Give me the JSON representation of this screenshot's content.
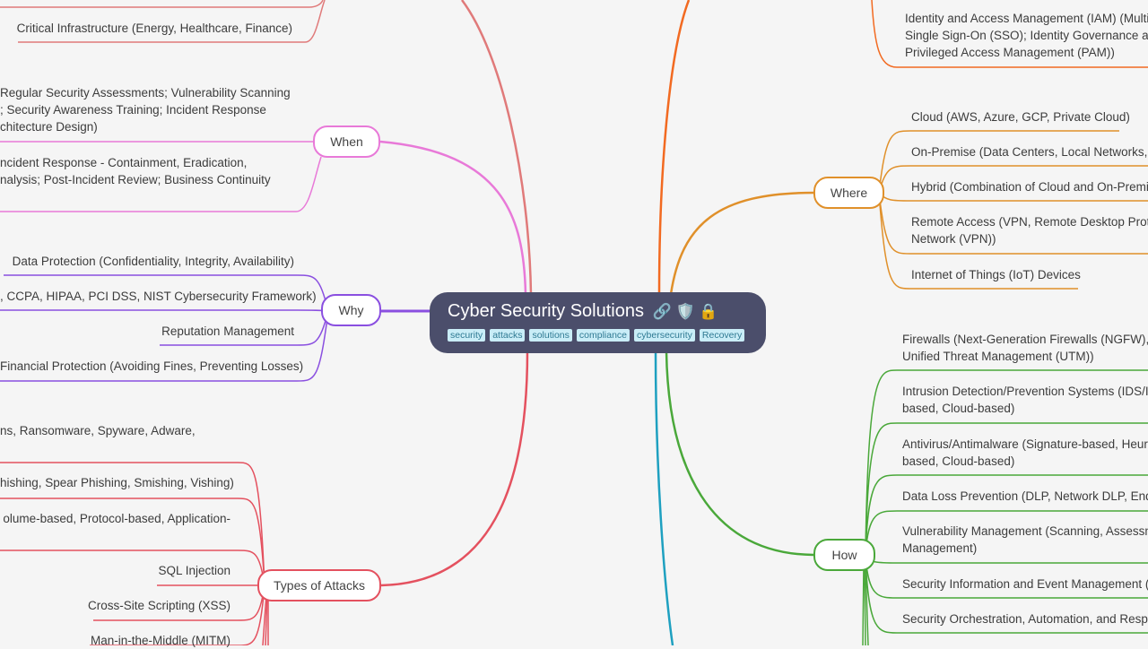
{
  "root": {
    "title": "Cyber Security Solutions",
    "icons": [
      "link-icon",
      "shield-icon",
      "lock-icon"
    ],
    "icon_glyphs": "🔗 🛡️ 🔒",
    "tags": [
      "security",
      "attacks",
      "solutions",
      "compliance",
      "cybersecurity",
      "Recovery"
    ]
  },
  "colors": {
    "what": "#e07a7a",
    "when": "#e879d8",
    "why": "#8a4fe0",
    "types_of_attacks": "#e4515f",
    "who": "#f26a21",
    "where": "#e0902a",
    "how": "#4aa83a",
    "bottom": "#1ea0c0"
  },
  "branches": {
    "when": {
      "label": "When",
      "children": [
        "Regular Security Assessments; Vulnerability Scanning\n; Security Awareness Training; Incident Response\nchitecture Design)",
        "ncident Response - Containment, Eradication,\nnalysis; Post-Incident Review; Business Continuity"
      ]
    },
    "why": {
      "label": "Why",
      "children": [
        "Data Protection (Confidentiality, Integrity, Availability)",
        ", CCPA, HIPAA, PCI DSS, NIST Cybersecurity Framework)",
        "Reputation Management",
        "Financial Protection (Avoiding Fines, Preventing Losses)"
      ]
    },
    "types_of_attacks": {
      "label": "Types of Attacks",
      "children": [
        "ns, Ransomware, Spyware, Adware,",
        "hishing, Spear Phishing, Smishing, Vishing)",
        "olume-based, Protocol-based, Application-",
        "SQL Injection",
        "Cross-Site Scripting (XSS)",
        "Man-in-the-Middle (MITM)"
      ]
    },
    "what_tail": {
      "children": [
        "Critical Infrastructure (Energy, Healthcare, Finance)"
      ]
    },
    "who_tail": {
      "children": [
        "Identity and Access Management (IAM) (Multi-\nSingle Sign-On (SSO); Identity Governance an\nPrivileged Access Management (PAM))"
      ]
    },
    "where": {
      "label": "Where",
      "children": [
        "Cloud (AWS, Azure, GCP, Private Cloud)",
        "On-Premise (Data Centers, Local Networks, E",
        "Hybrid (Combination of Cloud and On-Premi",
        "Remote Access (VPN, Remote Desktop Protoc\nNetwork (VPN))",
        "Internet of Things (IoT) Devices"
      ]
    },
    "how": {
      "label": "How",
      "children": [
        "Firewalls (Next-Generation Firewalls (NGFW), S\nUnified Threat Management (UTM))",
        "Intrusion Detection/Prevention Systems (IDS/I\nbased, Cloud-based)",
        "Antivirus/Antimalware (Signature-based, Heur\nbased, Cloud-based)",
        "Data Loss Prevention (DLP, Network DLP, Endp",
        "Vulnerability Management (Scanning, Assessm\nManagement)",
        "Security Information and Event Management (",
        "Security Orchestration, Automation, and Resp"
      ]
    }
  }
}
